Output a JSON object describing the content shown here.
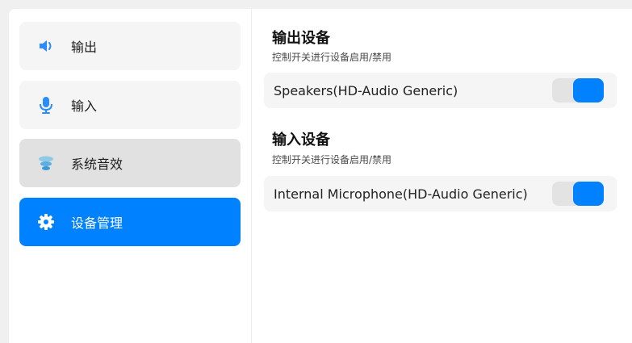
{
  "sidebar": {
    "items": [
      {
        "label": "输出",
        "icon": "speaker-icon"
      },
      {
        "label": "输入",
        "icon": "microphone-icon"
      },
      {
        "label": "系统音效",
        "icon": "sound-effects-icon"
      },
      {
        "label": "设备管理",
        "icon": "gear-icon"
      }
    ],
    "active_index": 3,
    "hover_index": 2
  },
  "output_section": {
    "title": "输出设备",
    "subtitle": "控制开关进行设备启用/禁用",
    "devices": [
      {
        "name": "Speakers(HD-Audio Generic)",
        "enabled": true
      }
    ]
  },
  "input_section": {
    "title": "输入设备",
    "subtitle": "控制开关进行设备启用/禁用",
    "devices": [
      {
        "name": "Internal Microphone(HD-Audio Generic)",
        "enabled": true
      }
    ]
  },
  "colors": {
    "accent": "#0081ff",
    "panel": "#f5f5f5",
    "hover": "#e1e1e1"
  }
}
